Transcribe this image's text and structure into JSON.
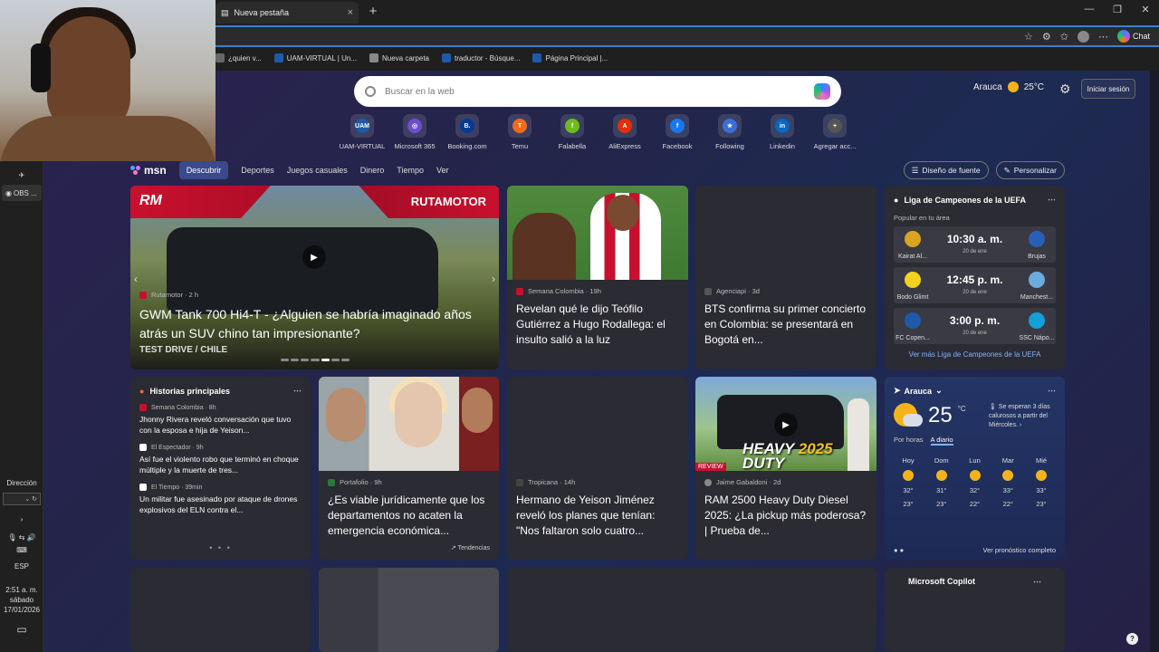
{
  "browser": {
    "tab_title": "Nueva pestaña",
    "chat_label": "Chat",
    "bookmarks": [
      {
        "label": "¿quien v...",
        "icon": "page-icon",
        "color": "#666666"
      },
      {
        "label": "UAM-VIRTUAL | Un...",
        "icon": "uam-icon",
        "color": "#1e5aa8"
      },
      {
        "label": "Nueva carpeta",
        "icon": "folder-icon",
        "color": "#888888"
      },
      {
        "label": "traductor - Búsque...",
        "icon": "search-icon",
        "color": "#1e5aa8"
      },
      {
        "label": "Página Principal |...",
        "icon": "uam-icon",
        "color": "#1e5aa8"
      }
    ]
  },
  "search": {
    "placeholder": "Buscar en la web"
  },
  "top_weather": {
    "location": "Arauca",
    "temp": "25",
    "unit": "°C"
  },
  "login_label": "Iniciar sesión",
  "quicklinks": [
    {
      "label": "UAM-VIRTUAL",
      "glyph": "UAM",
      "color": "#1e5aa8"
    },
    {
      "label": "Microsoft 365",
      "glyph": "◎",
      "color": "#6b4fd1"
    },
    {
      "label": "Booking.com",
      "glyph": "B.",
      "color": "#003b95"
    },
    {
      "label": "Temu",
      "glyph": "T",
      "color": "#f26b1d"
    },
    {
      "label": "Falabella",
      "glyph": "f",
      "color": "#6dbb1e"
    },
    {
      "label": "AliExpress",
      "glyph": "A",
      "color": "#e62e04"
    },
    {
      "label": "Facebook",
      "glyph": "f",
      "color": "#1877f2"
    },
    {
      "label": "Following",
      "glyph": "★",
      "color": "#3b6fd6"
    },
    {
      "label": "Linkedin",
      "glyph": "in",
      "color": "#0a66c2"
    },
    {
      "label": "Agregar acc...",
      "glyph": "+",
      "color": "#555555"
    }
  ],
  "msn": {
    "logo": "msn",
    "tabs": [
      "Descubrir",
      "Deportes",
      "Juegos casuales",
      "Dinero",
      "Tiempo",
      "Ver"
    ],
    "font_design": "Diseño de fuente",
    "personalize": "Personalizar"
  },
  "hero": {
    "brand_short": "RM",
    "brand": "RUTAMOTOR",
    "source": "Rutamotor · 2 h",
    "headline": "GWM Tank 700 Hi4-T - ¿Alguien se habría imaginado años atrás un SUV chino tan impresionante?",
    "sub": "TEST DRIVE / CHILE"
  },
  "card2": {
    "source": "Semana Colombia · 19h",
    "headline": "Revelan qué le dijo Teófilo Gutiérrez a Hugo Rodallega: el insulto salió a la luz"
  },
  "card3": {
    "source": "Agenciapi · 3d",
    "headline": "BTS confirma su primer concierto en Colombia: se presentará en Bogotá en..."
  },
  "uefa": {
    "title": "Liga de Campeones de la UEFA",
    "area": "Popular en tu área",
    "matches": [
      {
        "home": "Kairat Al...",
        "time": "10:30 a. m.",
        "date": "20 de ene",
        "away": "Brujas",
        "home_color": "#d9a520",
        "away_color": "#2a5fb8"
      },
      {
        "home": "Bodo Glimt",
        "time": "12:45 p. m.",
        "date": "20 de ene",
        "away": "Manchest...",
        "home_color": "#f2d21b",
        "away_color": "#6cabdd"
      },
      {
        "home": "FC Copen...",
        "time": "3:00 p. m.",
        "date": "20 de ene",
        "away": "SSC Nápo...",
        "home_color": "#1e5aa8",
        "away_color": "#12a0d7"
      }
    ],
    "link": "Ver más Liga de Campeones de la UEFA"
  },
  "stories": {
    "title": "Historias principales",
    "items": [
      {
        "source": "Semana Colombia · 8h",
        "text": "Jhonny Rivera reveló conversación que tuvo con la esposa e hija de Yeison...",
        "color": "#c8102e"
      },
      {
        "source": "El Espectador · 9h",
        "text": "Así fue el violento robo que terminó en choque múltiple y la muerte de tres...",
        "color": "#ffffff"
      },
      {
        "source": "El Tiempo · 39min",
        "text": "Un militar fue asesinado por ataque de drones explosivos del ELN contra el...",
        "color": "#ffffff"
      }
    ],
    "pager": "• • •"
  },
  "card5": {
    "source": "Portafolio · 9h",
    "headline": "¿Es viable jurídicamente que los departamentos no acaten la emergencia económica...",
    "trend": "Tendencias"
  },
  "card6": {
    "source": "Tropicana · 14h",
    "headline": "Hermano de Yeison Jiménez reveló los planes que tenían: \"Nos faltaron solo cuatro..."
  },
  "card7": {
    "source": "Jaime Gabaldoni · 2d",
    "headline": "RAM 2500 Heavy Duty Diesel 2025: ¿La pickup más poderosa? | Prueba de...",
    "img_text1": "HEAVY",
    "img_text2": "2025",
    "img_text3": "DUTY",
    "review": "REVIEW"
  },
  "weather": {
    "location": "Arauca",
    "temp": "25",
    "unit": "°C",
    "alert": "Se esperan 3 días calurosos a partir del Miércoles.",
    "toggle_hourly": "Por horas",
    "toggle_daily": "A diario",
    "days": [
      {
        "name": "Hoy",
        "hi": "32°",
        "lo": "23°"
      },
      {
        "name": "Dom",
        "hi": "31°",
        "lo": "23°"
      },
      {
        "name": "Lun",
        "hi": "32°",
        "lo": "22°"
      },
      {
        "name": "Mar",
        "hi": "33°",
        "lo": "22°"
      },
      {
        "name": "Mié",
        "hi": "33°",
        "lo": "23°"
      }
    ],
    "forecast_link": "Ver pronóstico completo"
  },
  "copilot": {
    "title": "Microsoft Copilot"
  },
  "taskbar": {
    "obs": "OBS ...",
    "direction_label": "Dirección",
    "lang": "ESP",
    "time": "2:51 a. m.",
    "weekday": "sábado",
    "date": "17/01/2026"
  }
}
